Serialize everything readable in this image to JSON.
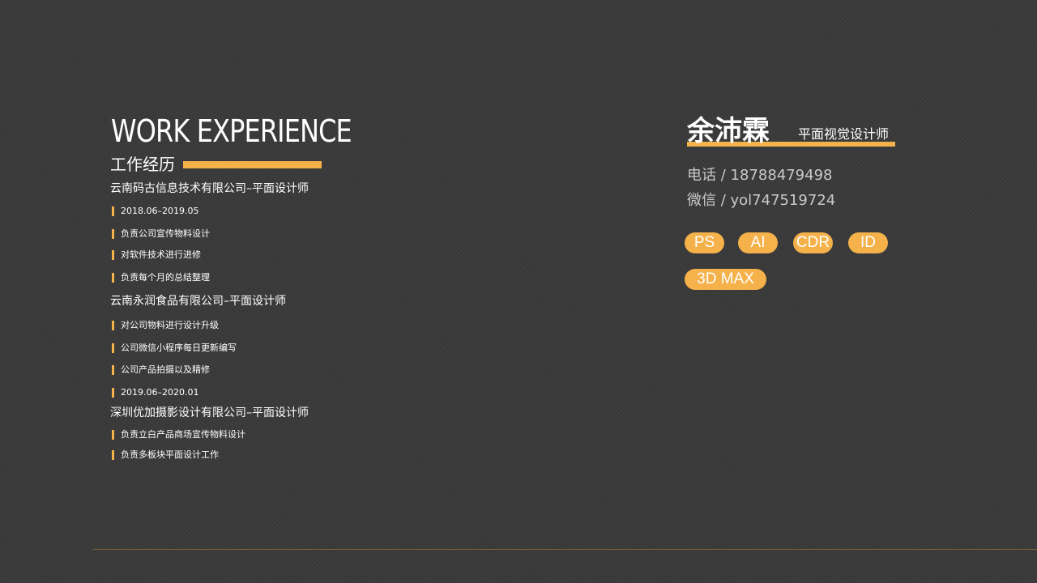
{
  "work": {
    "heading_en": "WORK EXPERIENCE",
    "heading_cn": "工作经历",
    "companies": [
      "云南码古信息技术有限公司–平面设计师",
      "云南永润食品有限公司–平面设计师",
      "深圳优加摄影设计有限公司–平面设计师"
    ],
    "items": [
      "2018.06–2019.05",
      "负责公司宣传物料设计",
      "对软件技术进行进修",
      "负责每个月的总结整理",
      "对公司物料进行设计升级",
      "公司微信小程序每日更新编写",
      "公司产品拍摄以及精修",
      "2019.06–2020.01",
      "负责立白产品商场宣传物料设计",
      "负责多板块平面设计工作"
    ]
  },
  "profile": {
    "name": "余沛霖",
    "role": "平面视觉设计师",
    "phone": "电话 / 18788479498",
    "wechat": "微信 / yol747519724"
  },
  "skills": [
    "PS",
    "AI",
    "CDR",
    "ID",
    "3D MAX"
  ],
  "colors": {
    "accent": "#f5b14a",
    "background": "#3a3a3a",
    "text": "#ffffff",
    "muted_text": "#c9c9c9"
  }
}
